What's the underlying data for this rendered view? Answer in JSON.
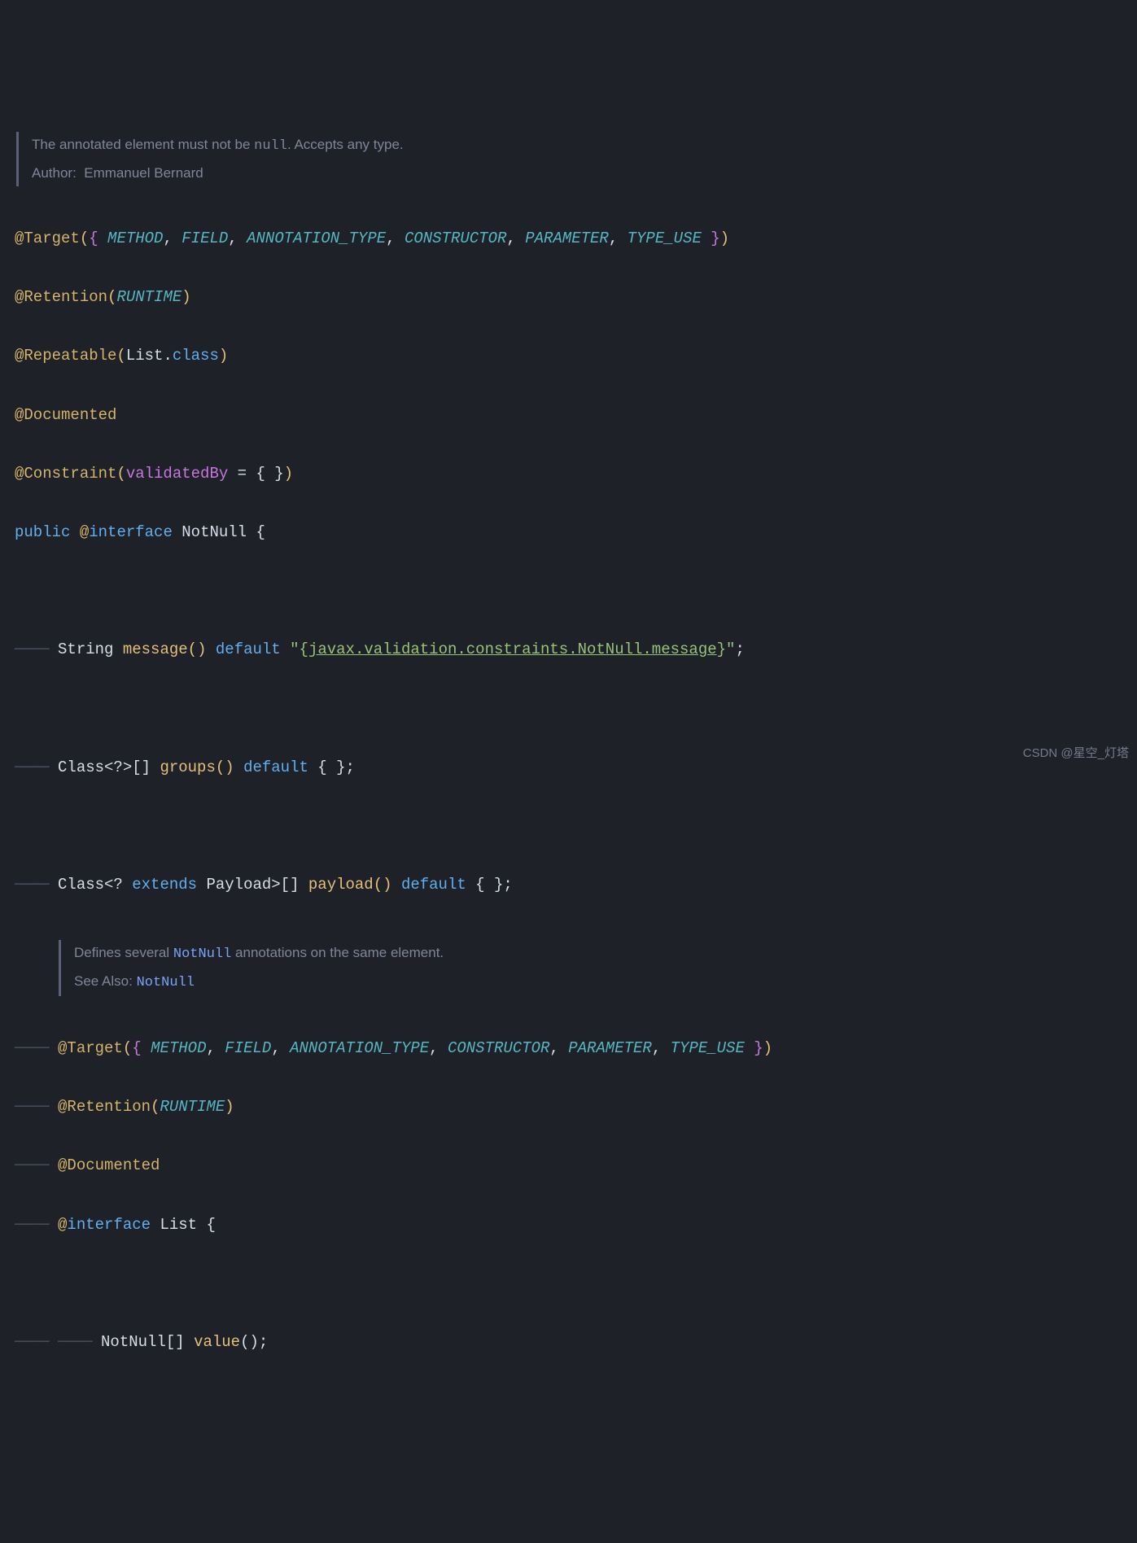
{
  "javadoc_top": {
    "desc_prefix": "The annotated element must not be ",
    "desc_code": "null",
    "desc_suffix": ". Accepts any type.",
    "author_label": "Author:",
    "author_name": "Emmanuel Bernard"
  },
  "annotations": {
    "target": "@Target",
    "retention": "@Retention",
    "repeatable": "@Repeatable",
    "documented": "@Documented",
    "constraint": "@Constraint"
  },
  "enums": {
    "method": "METHOD",
    "field": "FIELD",
    "annotation_type": "ANNOTATION_TYPE",
    "constructor": "CONSTRUCTOR",
    "parameter": "PARAMETER",
    "type_use": "TYPE_USE",
    "runtime": "RUNTIME"
  },
  "repeatable_arg": {
    "list": "List",
    "dot": ".",
    "class_kw": "class"
  },
  "constraint_arg": {
    "param": "validatedBy",
    "eq": " = { }"
  },
  "decl": {
    "public": "public",
    "at_interface": "@interface",
    "name": "NotNull",
    "brace": " {"
  },
  "members": {
    "string": "String",
    "message": "message",
    "default_kw": "default",
    "message_default_open": " \"{",
    "message_default_link": "javax.validation.constraints.NotNull.message",
    "message_default_close": "}\"",
    "semi": ";",
    "class_groups_pre": "Class<?>[] ",
    "groups": "groups",
    "groups_default": " { }",
    "class_payload_pre1": "Class<? ",
    "extends_kw": "extends",
    "class_payload_pre2": " Payload>[] ",
    "payload": "payload",
    "payload_default": " { }"
  },
  "inner_doc": {
    "prefix": "Defines several ",
    "notnull": "NotNull",
    "suffix": " annotations on the same element.",
    "seealso_label": "See Also:",
    "seealso_ref": "NotNull"
  },
  "inner": {
    "interface_kw": "interface",
    "list_name": "List",
    "brace_open": " {",
    "value_type": "NotNull[] ",
    "value_name": "value",
    "value_end": "();"
  },
  "watermark": "CSDN @星空_灯塔"
}
